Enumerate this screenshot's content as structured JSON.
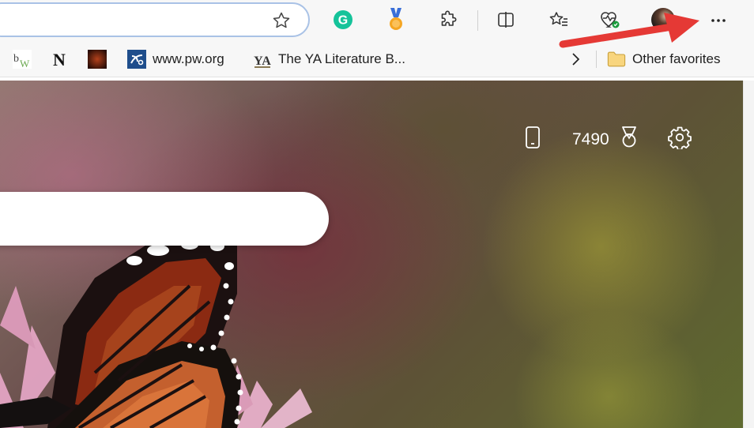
{
  "toolbar": {
    "favorite_star_icon": "star-outline-icon",
    "extensions": [
      {
        "name": "grammarly-icon",
        "color": "#15c39a",
        "glyph": "G"
      },
      {
        "name": "rewards-medal-icon",
        "color": "#f0a830"
      },
      {
        "name": "extensions-puzzle-icon"
      },
      {
        "name": "split-screen-icon"
      },
      {
        "name": "favorites-star-list-icon"
      },
      {
        "name": "browser-essentials-heart-icon"
      },
      {
        "name": "profile-avatar"
      },
      {
        "name": "settings-and-more-icon",
        "glyph": "···"
      }
    ]
  },
  "favorites": {
    "items": [
      {
        "label": "",
        "icon": "bw-site-icon"
      },
      {
        "label": "",
        "icon": "n-site-icon"
      },
      {
        "label": "",
        "icon": "dark-image-site-icon"
      },
      {
        "label": "www.pw.org",
        "icon": "pw-site-icon"
      },
      {
        "label": "The YA Literature B...",
        "icon": "ya-site-icon"
      }
    ],
    "overflow_icon": "chevron-right-icon",
    "other_favorites_label": "Other favorites"
  },
  "page": {
    "rewards_points": "7490",
    "phone_icon": "mobile-phone-icon",
    "trophy_icon": "trophy-icon",
    "settings_icon": "gear-icon"
  },
  "annotation": {
    "arrow_color": "#e53935"
  }
}
